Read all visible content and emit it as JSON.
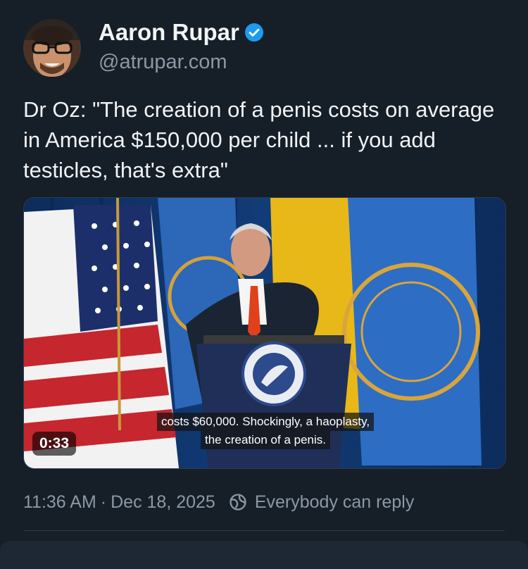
{
  "author": {
    "display_name": "Aaron Rupar",
    "handle": "@atrupar.com",
    "verified": true
  },
  "post": {
    "text": "Dr Oz: \"The creation of a penis costs on average in America $150,000 per child ... if you add testicles, that's extra\""
  },
  "video": {
    "duration": "0:33",
    "caption_lines": [
      "costs $60,000. Shockingly, a haoplasty,",
      "the creation of a penis."
    ]
  },
  "meta": {
    "time": "11:36 AM",
    "separator": "·",
    "date": "Dec 18, 2025",
    "reply_setting": "Everybody can reply"
  },
  "colors": {
    "background": "#161e27",
    "text": "#f1f3f5",
    "muted": "#8b98a5",
    "verified": "#1d9bf0"
  }
}
